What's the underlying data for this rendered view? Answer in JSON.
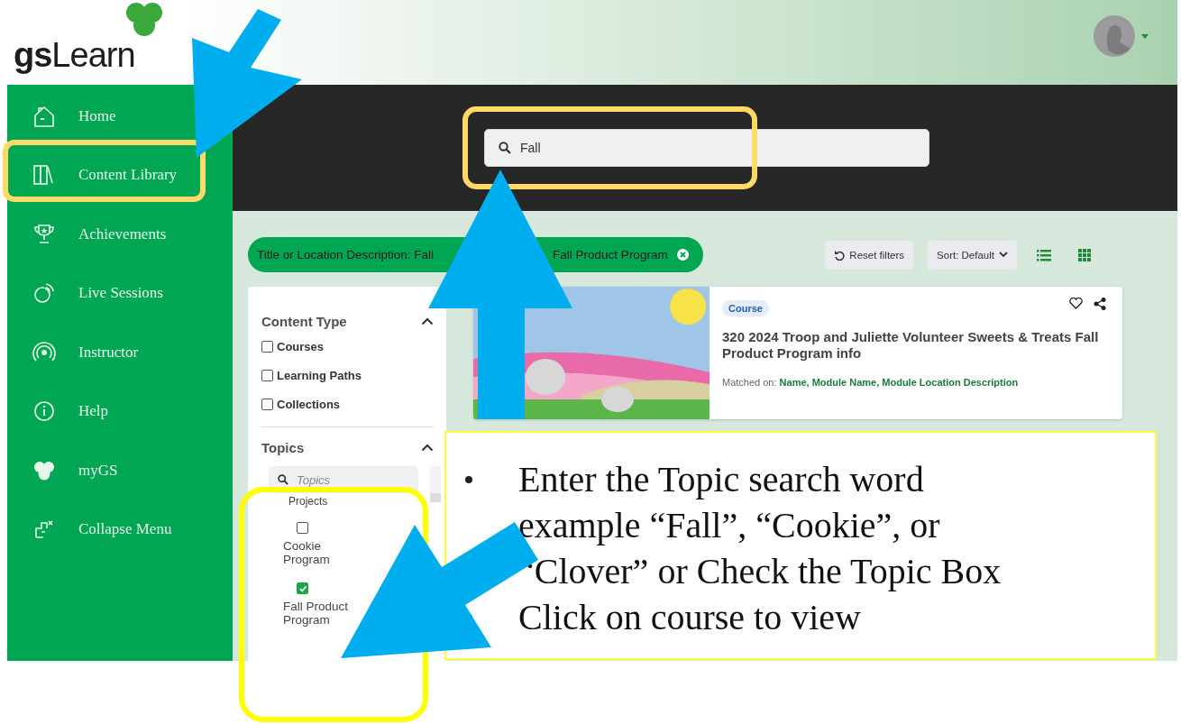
{
  "header": {
    "logo": "**gs**Learn"
  },
  "sidebar": {
    "items": [
      {
        "label": "Home"
      },
      {
        "label": "Content Library"
      },
      {
        "label": "Achievements"
      },
      {
        "label": "Live Sessions"
      },
      {
        "label": "Instructor"
      },
      {
        "label": "Help"
      },
      {
        "label": "myGS"
      },
      {
        "label": "Collapse Menu"
      }
    ]
  },
  "search": {
    "value": "Fall"
  },
  "filter_chip": {
    "text_start": "Title or Location Description: Fall",
    "text_end": "Fall Product Program"
  },
  "toolbar": {
    "reset": "Reset filters",
    "sort": "Sort: Default"
  },
  "filters": {
    "content_type": {
      "title": "Content Type",
      "expanded": true,
      "items": [
        {
          "label": "Courses",
          "checked": false
        },
        {
          "label": "Learning Paths",
          "checked": false
        },
        {
          "label": "Collections",
          "checked": false
        }
      ]
    },
    "topics": {
      "title": "Topics",
      "expanded": true,
      "placeholder": "Topics",
      "partial_item": "Projects",
      "items": [
        {
          "label": "Cookie Program",
          "checked": false
        },
        {
          "label": "Fall Product Program",
          "checked": true
        }
      ]
    }
  },
  "results": [
    {
      "badge": "Course",
      "title": "320 2024 Troop and Juliette Volunteer Sweets & Treats Fall Product Program info",
      "matched": "Matched on: **Name, Module Name, Module Location Description**"
    }
  ],
  "callout": {
    "bullets": [
      "Enter the Topic search word example “Fall”, “Cookie”, or “Clover” or Check the Topic Box",
      "Click on course to view"
    ]
  }
}
